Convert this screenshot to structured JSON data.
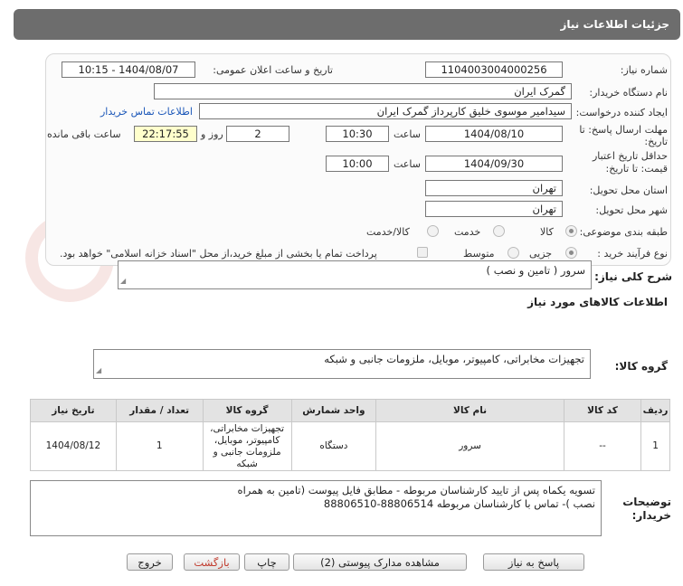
{
  "header": {
    "title": "جزئیات اطلاعات نیاز"
  },
  "form": {
    "need_number_label": "شماره نیاز:",
    "need_number": "1104003004000256",
    "announce_label": "تاریخ و ساعت اعلان عمومی:",
    "announce_value": "1404/08/07 - 10:15",
    "buyer_org_label": "نام دستگاه خریدار:",
    "buyer_org": "گمرک ایران",
    "creator_label": "ایجاد کننده درخواست:",
    "creator": "سیدامیر موسوی خلیق کارپرداز گمرک ایران",
    "contact_link": "اطلاعات تماس خریدار",
    "deadline_label_1": "مهلت ارسال پاسخ: تا",
    "deadline_label_2": "تاریخ:",
    "deadline_date": "1404/08/10",
    "time_label": "ساعت",
    "deadline_time": "10:30",
    "days_value": "2",
    "days_label": "روز و",
    "remaining_time": "22:17:55",
    "remaining_label": "ساعت باقی مانده",
    "validity_label_1": "حداقل تاریخ اعتبار",
    "validity_label_2": "قیمت: تا تاریخ:",
    "validity_date": "1404/09/30",
    "validity_time": "10:00",
    "province_label": "استان محل تحویل:",
    "province": "تهران",
    "city_label": "شهر محل تحویل:",
    "city": "تهران",
    "category_label": "طبقه بندی موضوعی:",
    "category_options": [
      "کالا",
      "خدمت",
      "کالا/خدمت"
    ],
    "process_label": "نوع فرآیند خرید :",
    "process_options": [
      "جزیی",
      "متوسط"
    ],
    "payment_note": "پرداخت تمام یا بخشی از مبلغ خرید،از محل \"اسناد خزانه اسلامی\" خواهد بود."
  },
  "summary": {
    "label": "شرح کلی نیاز:",
    "value": "سرور ( تامین و نصب )"
  },
  "goods": {
    "section_title": "اطلاعات کالاهای مورد نیاز",
    "group_label": "گروه کالا:",
    "group_value": "تجهیزات مخابراتی، کامپیوتر، موبایل، ملزومات جانبی و شبکه"
  },
  "table": {
    "headers": [
      "ردیف",
      "کد کالا",
      "نام کالا",
      "واحد شمارش",
      "گروه کالا",
      "تعداد / مقدار",
      "تاریخ نیاز"
    ],
    "rows": [
      {
        "row": "1",
        "code": "--",
        "name": "سرور",
        "unit": "دستگاه",
        "group": "تجهیزات مخابراتی، کامپیوتر، موبایل، ملزومات جانبی و شبکه",
        "qty": "1",
        "date": "1404/08/12"
      }
    ]
  },
  "notes": {
    "label_1": "توضیحات",
    "label_2": "خریدار:",
    "line1": "تسویه یکماه پس از تایید کارشناسان مربوطه - مطابق فایل پیوست (تامین به همراه",
    "line2": "نصب )- تماس با کارشناسان مربوطه 88806514-88806510"
  },
  "buttons": {
    "reply": "پاسخ به نیاز",
    "view_docs": "مشاهده مدارک پیوستی (2)",
    "print": "چاپ",
    "back": "بازگشت",
    "exit": "خروج"
  },
  "watermark": {
    "text": "AriaTender.neT"
  },
  "colors": {
    "header_bg": "#6d6d6d",
    "link": "#1a56b8",
    "remaining_bg": "#ffffcc",
    "back_text": "#c0392b"
  }
}
